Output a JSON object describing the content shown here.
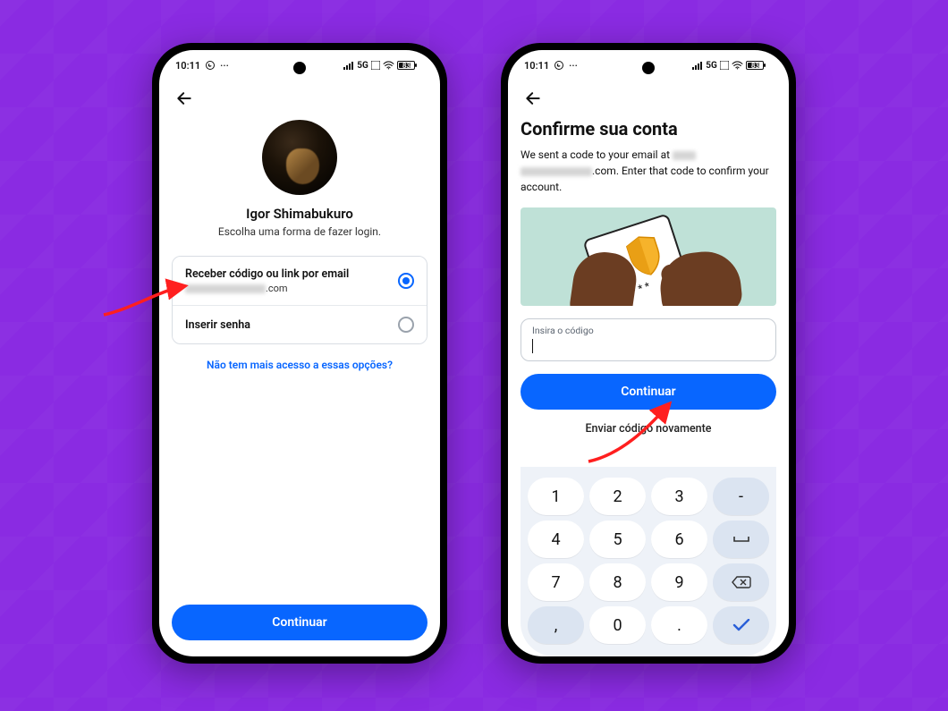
{
  "status_bar": {
    "time": "10:11",
    "whatsapp_icon": true,
    "more_dots": "···",
    "network_label": "5G",
    "battery_percent": "83"
  },
  "phone1": {
    "user_name": "Igor Shimabukuro",
    "subtitle": "Escolha uma forma de fazer login.",
    "option_email_title": "Receber código ou link por email",
    "option_email_domain": ".com",
    "option_password_title": "Inserir senha",
    "help_link": "Não tem mais acesso a essas opções?",
    "continue_label": "Continuar"
  },
  "phone2": {
    "title": "Confirme sua conta",
    "desc_prefix": "We sent a code to your email at ",
    "desc_domain_suffix": ".com. Enter that code to confirm your account.",
    "code_label": "Insira o código",
    "continue_label": "Continuar",
    "resend_label": "Enviar código novamente",
    "illus_dots": "*****"
  },
  "keypad": {
    "k1": "1",
    "k2": "2",
    "k3": "3",
    "dash": "-",
    "k4": "4",
    "k5": "5",
    "k6": "6",
    "k7": "7",
    "k8": "8",
    "k9": "9",
    "k0": "0",
    "comma": ",",
    "dot": "."
  }
}
